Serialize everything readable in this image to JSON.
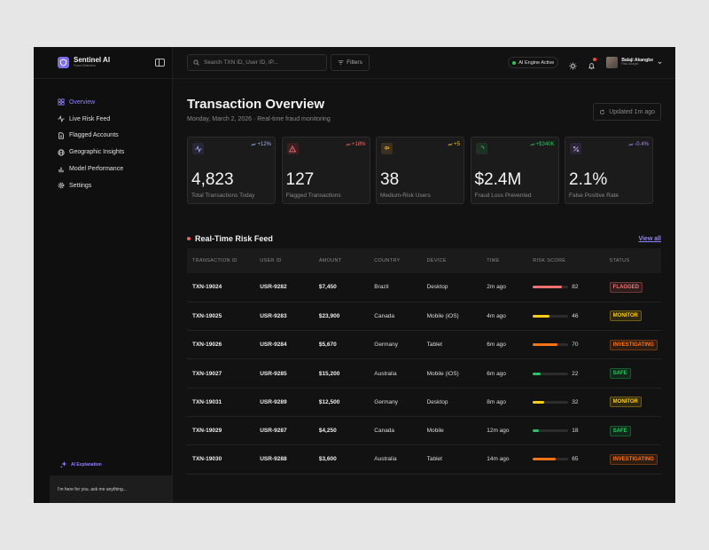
{
  "brand": {
    "name": "Sentinel AI",
    "subtitle": "Fraud Detection"
  },
  "nav": [
    {
      "label": "Overview",
      "icon": "grid-icon",
      "active": true
    },
    {
      "label": "Live Risk Feed",
      "icon": "activity-icon",
      "active": false
    },
    {
      "label": "Flagged Accounts",
      "icon": "document-icon",
      "active": false
    },
    {
      "label": "Geographic Insights",
      "icon": "globe-icon",
      "active": false
    },
    {
      "label": "Model Performance",
      "icon": "bar-chart-icon",
      "active": false
    },
    {
      "label": "Settings",
      "icon": "gear-icon",
      "active": false
    }
  ],
  "ai_explanation": "AI Explanation",
  "chat_placeholder": "I'm here for you, ask me anything...",
  "topbar": {
    "search_placeholder": "Search TXN ID, User ID, IP...",
    "filters_label": "Filters",
    "engine_status": "AI Engine Active",
    "user_name": "Balaji Akangbe",
    "user_role": "Risk Analyst"
  },
  "page": {
    "title": "Transaction Overview",
    "subtitle": "Monday, March 2, 2026 · Real-time fraud monitoring",
    "updated": "Updated 1m ago"
  },
  "cards": [
    {
      "value": "4,823",
      "label": "Total Transactions Today",
      "delta": "+12%",
      "delta_color": "#a5b4fc",
      "icon": "activity-icon",
      "icon_color": "#a5b4fc",
      "icon_bg": "#262636"
    },
    {
      "value": "127",
      "label": "Flagged Transactions",
      "delta": "+18%",
      "delta_color": "#f87171",
      "icon": "alert-triangle-icon",
      "icon_color": "#f87171",
      "icon_bg": "#3a2020"
    },
    {
      "value": "38",
      "label": "Medium-Risk Users",
      "delta": "+5",
      "delta_color": "#fbbf24",
      "icon": "users-icon",
      "icon_color": "#fbbf24",
      "icon_bg": "#3a3020"
    },
    {
      "value": "$2.4M",
      "label": "Fraud Loss Prevented",
      "delta": "+$340K",
      "delta_color": "#22c55e",
      "icon": "shield-icon",
      "icon_color": "#22c55e",
      "icon_bg": "#1c3324"
    },
    {
      "value": "2.1%",
      "label": "False Positive Rate",
      "delta": "-0.4%",
      "delta_color": "#a78bfa",
      "icon": "percent-icon",
      "icon_color": "#c4b5fd",
      "icon_bg": "#2a2436"
    }
  ],
  "feed": {
    "title": "Real-Time Risk Feed",
    "view_all": "View all",
    "columns": [
      "TRANSACTION ID",
      "USER ID",
      "AMOUNT",
      "COUNTRY",
      "DEVICE",
      "TIME",
      "RISK SCORE",
      "STATUS"
    ],
    "rows": [
      {
        "txn": "TXN-19024",
        "user": "USR-9282",
        "amount": "$7,450",
        "country": "Brazil",
        "device": "Desktop",
        "time": "2m ago",
        "score": "82",
        "score_value": 82,
        "bar_color": "#f87171",
        "status": "FLAGGED",
        "status_color": "#f87171"
      },
      {
        "txn": "TXN-19025",
        "user": "USR-9283",
        "amount": "$23,900",
        "country": "Canada",
        "device": "Mobile (iOS)",
        "time": "4m ago",
        "score": "46",
        "score_value": 46,
        "bar_color": "#facc15",
        "status": "MONITOR",
        "status_color": "#facc15"
      },
      {
        "txn": "TXN-19026",
        "user": "USR-9284",
        "amount": "$5,670",
        "country": "Germany",
        "device": "Tablet",
        "time": "6m ago",
        "score": "70",
        "score_value": 70,
        "bar_color": "#f97316",
        "status": "INVESTIGATING",
        "status_color": "#f97316"
      },
      {
        "txn": "TXN-19027",
        "user": "USR-9285",
        "amount": "$15,200",
        "country": "Australia",
        "device": "Mobile (iOS)",
        "time": "6m ago",
        "score": "22",
        "score_value": 22,
        "bar_color": "#22c55e",
        "status": "SAFE",
        "status_color": "#22c55e"
      },
      {
        "txn": "TXN-19031",
        "user": "USR-9289",
        "amount": "$12,500",
        "country": "Germany",
        "device": "Desktop",
        "time": "8m ago",
        "score": "32",
        "score_value": 32,
        "bar_color": "#facc15",
        "status": "MONITOR",
        "status_color": "#facc15"
      },
      {
        "txn": "TXN-19029",
        "user": "USR-9287",
        "amount": "$4,250",
        "country": "Canada",
        "device": "Mobile",
        "time": "12m ago",
        "score": "18",
        "score_value": 18,
        "bar_color": "#22c55e",
        "status": "SAFE",
        "status_color": "#22c55e"
      },
      {
        "txn": "TXN-19030",
        "user": "USR-9288",
        "amount": "$3,600",
        "country": "Australia",
        "device": "Tablet",
        "time": "14m ago",
        "score": "65",
        "score_value": 65,
        "bar_color": "#f97316",
        "status": "INVESTIGATING",
        "status_color": "#f97316"
      }
    ]
  }
}
